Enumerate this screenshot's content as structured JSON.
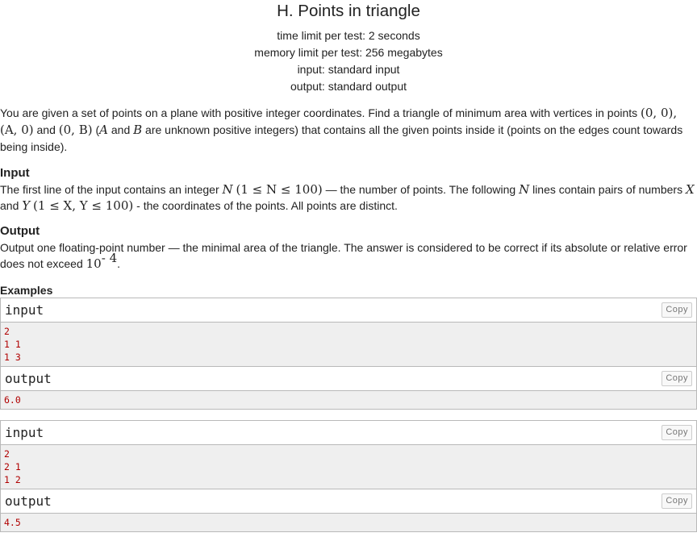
{
  "problem": {
    "title": "H. Points in triangle",
    "time_limit": "time limit per test: 2 seconds",
    "memory_limit": "memory limit per test: 256 megabytes",
    "input_file": "input: standard input",
    "output_file": "output: standard output"
  },
  "legend": {
    "t1": "You are given a set of points on a plane with positive integer coordinates. Find a triangle of minimum area with vertices in points ",
    "t2": " and ",
    "t3": " (",
    "t4": " and ",
    "t5": " are unknown positive integers) that contains all the given points inside it (points on the edges count towards being inside).",
    "m_origin": "(0, 0),",
    "m_a0": "(A, 0)",
    "m_0b": "(0, B)",
    "m_A": "A",
    "m_B": "B"
  },
  "input_spec": {
    "title": "Input",
    "t1": "The first line of the input contains an integer ",
    "t2": " — the number of points. The following ",
    "t3": " lines contain pairs of numbers ",
    "t4": " and ",
    "t5": " - the coordinates of the points. All points are distinct.",
    "m_N": "N",
    "m_Nrange": "(1 ≤ N ≤ 100)",
    "m_N2": "N",
    "m_X": "X",
    "m_Y": "Y",
    "m_XYrange": "(1 ≤ X, Y ≤ 100)"
  },
  "output_spec": {
    "title": "Output",
    "t1": "Output one floating-point number — the minimal area of the triangle. The answer is considered to be correct if its absolute or relative error does not exceed ",
    "m_base": "10",
    "m_exp": "- 4",
    "t2": "."
  },
  "examples": {
    "title": "Examples",
    "input_label": "input",
    "output_label": "output",
    "copy_label": "Copy",
    "tests": [
      {
        "input": "2\n1 1\n1 3",
        "output": "6.0"
      },
      {
        "input": "2\n2 1\n1 2",
        "output": "4.5"
      }
    ]
  }
}
